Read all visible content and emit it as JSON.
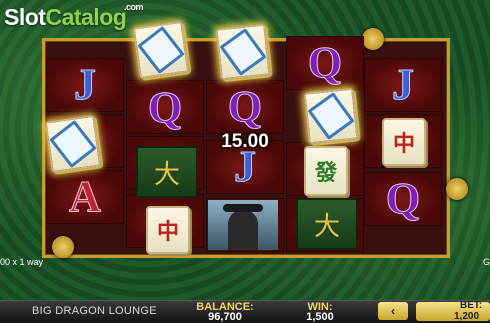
{
  "logo": {
    "slot": "Slot",
    "catalog": "Catalog",
    "com": ".com"
  },
  "symbols": {
    "J": "J",
    "Q": "Q",
    "A": "A",
    "red_char": "中",
    "green_char": "發",
    "book_char": "大"
  },
  "win_amount": "15.00",
  "ways_text": "00 x 1 way",
  "right_tag": "G",
  "game_name": "BIG DRAGON LOUNGE",
  "balance": {
    "label": "BALANCE:",
    "value": "96,700"
  },
  "win": {
    "label": "WIN:",
    "value": "1,500"
  },
  "bet": {
    "label": "BET:",
    "value": "1,200"
  },
  "nav_arrow": "‹",
  "colors": {
    "gold": "#c89b2e",
    "label_yellow": "#f1d65a",
    "felt_green": "#174a22"
  }
}
